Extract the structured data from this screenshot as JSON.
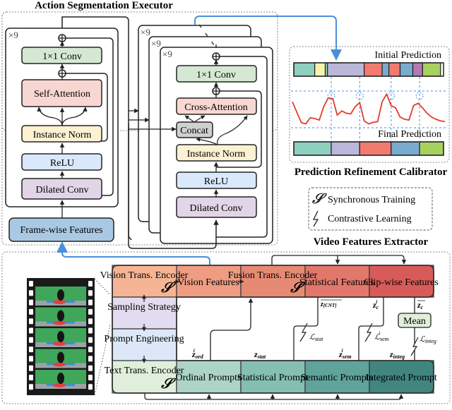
{
  "titles": {
    "executor": "Action Segmentation Executor",
    "calibrator": "Prediction Refinement Calibrator",
    "extractor": "Video Features Extractor"
  },
  "executor": {
    "repeat": "×9",
    "left_stage": {
      "blocks": [
        "1×1 Conv",
        "Self-Attention",
        "Instance Norm",
        "ReLU",
        "Dilated Conv"
      ],
      "input": "Frame-wise Features"
    },
    "right_stage": {
      "blocks": [
        "1×1 Conv",
        "Cross-Attention",
        "Concat",
        "Instance Norm",
        "ReLU",
        "Dilated Conv"
      ]
    }
  },
  "calibrator": {
    "initial_label": "Initial Prediction",
    "final_label": "Final Prediction",
    "initial_segments": [
      {
        "color": "#8ecfc0",
        "w": 0.14
      },
      {
        "color": "#f7f3ad",
        "w": 0.07
      },
      {
        "color": "#8ecfc0",
        "w": 0.015
      },
      {
        "color": "#bab7d9",
        "w": 0.245
      },
      {
        "color": "#f07b6e",
        "w": 0.12
      },
      {
        "color": "#7aaace",
        "w": 0.045
      },
      {
        "color": "#f07b6e",
        "w": 0.075
      },
      {
        "color": "#7aaace",
        "w": 0.085
      },
      {
        "color": "#b279b5",
        "w": 0.065
      },
      {
        "color": "#a6d15f",
        "w": 0.12
      }
    ],
    "final_segments": [
      {
        "color": "#8ecfc0",
        "w": 0.25
      },
      {
        "color": "#bab7d9",
        "w": 0.19
      },
      {
        "color": "#f07b6e",
        "w": 0.21
      },
      {
        "color": "#7aaace",
        "w": 0.19
      },
      {
        "color": "#a6d15f",
        "w": 0.16
      }
    ],
    "boundary_curve": [
      0.7,
      0.42,
      0.15,
      0.12,
      0.28,
      0.26,
      0.22,
      0.58,
      0.8,
      0.78,
      0.35,
      0.46,
      0.4,
      0.38,
      0.57,
      0.68,
      0.2,
      0.12,
      0.16,
      0.18,
      0.7,
      0.9,
      0.6,
      0.54,
      0.3,
      0.24,
      0.22,
      0.6,
      0.66,
      0.54,
      0.4,
      0.3,
      0.24,
      0.2,
      0.18
    ]
  },
  "legend": {
    "sync": "Synchronous Training",
    "contrastive": "Contrastive Learning"
  },
  "extractor": {
    "left_column": [
      "Vision Trans. Encoder",
      "Sampling Strategy",
      "Prompt Engineering",
      "Text Trans. Encoder"
    ],
    "top_row": [
      "Vision Features",
      "Fusion Trans. Encoder",
      "Statistical Features",
      "Clip-wise Features"
    ],
    "bottom_row": [
      "Ordinal Prompts",
      "Statistical Prompt",
      "Semantic Prompts",
      "Integrated Prompt"
    ],
    "mean": "Mean",
    "symbols": {
      "z_cnt": "z[CNT]",
      "z_c_i": "z_c^i",
      "z_c_bar": "z_c",
      "z_ord": "z_ord^i",
      "z_stat": "z_stat",
      "z_sem": "z_sem^i",
      "z_integ": "z_integ",
      "L_stat": "L_stat",
      "L_sem": "L_sem^i",
      "L_integ": "L_integ"
    }
  },
  "colors": {
    "conv": "#d5e8d4",
    "attn": "#f8d7d3",
    "norm": "#fdf1d3",
    "relu": "#dae8fc",
    "dilated": "#e1d5e7",
    "concat": "#d0d0d0",
    "framewise": "#a9c8e3",
    "accent_blue": "#4a90d9",
    "curve_red": "#e53a2a"
  }
}
